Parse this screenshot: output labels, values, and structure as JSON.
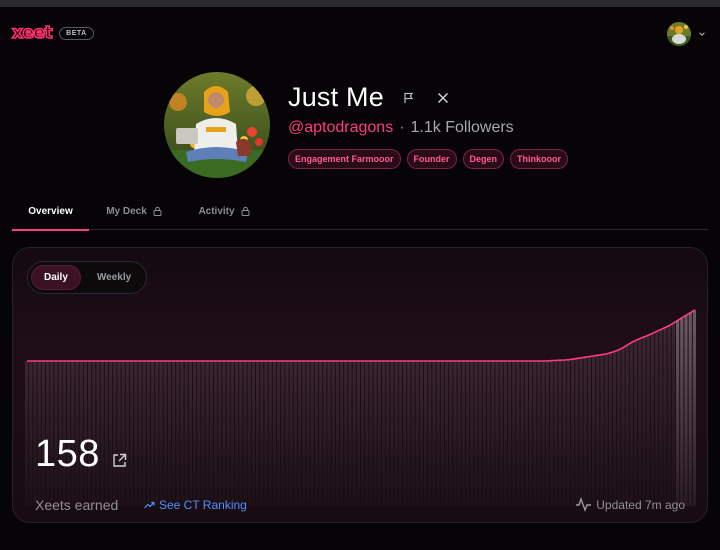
{
  "app": {
    "logo_text": "xeet",
    "beta_label": "BETA"
  },
  "account": {
    "avatar_icon": "user-avatar",
    "menu_icon": "chevron-down-icon"
  },
  "profile": {
    "display_name": "Just Me",
    "handle": "@aptodragons",
    "separator": "·",
    "followers": "1.1k Followers",
    "tags": [
      "Engagement Farmooor",
      "Founder",
      "Degen",
      "Thinkooor"
    ]
  },
  "tabs": [
    {
      "label": "Overview",
      "active": true,
      "locked": false
    },
    {
      "label": "My Deck",
      "active": false,
      "locked": true
    },
    {
      "label": "Activity",
      "active": false,
      "locked": true
    }
  ],
  "stats": {
    "period_toggle": [
      {
        "label": "Daily",
        "selected": true
      },
      {
        "label": "Weekly",
        "selected": false
      }
    ],
    "value": "158",
    "value_label": "Xeets earned",
    "ranking_link": "See CT Ranking",
    "updated": "Updated 7m ago"
  },
  "colors": {
    "accent": "#ff3d7f",
    "link": "#4f8fff",
    "background": "#060406"
  },
  "chart_data": {
    "type": "area",
    "title": "",
    "xlabel": "",
    "ylabel": "",
    "y": [
      1,
      1,
      1,
      1,
      1,
      1,
      1,
      1,
      1,
      1,
      1,
      1,
      1,
      1,
      1,
      1,
      1,
      1,
      1,
      1,
      1,
      1,
      1,
      1,
      1,
      1,
      1,
      1,
      1,
      1,
      1,
      1,
      1,
      1,
      1,
      1,
      1,
      1,
      1,
      1,
      1,
      1,
      1,
      1,
      1,
      1,
      1,
      1,
      1,
      1,
      1,
      1,
      1,
      1,
      1,
      1,
      1,
      1,
      1,
      1,
      1,
      1,
      1,
      1,
      1,
      1,
      1,
      1,
      1,
      1,
      1,
      1,
      1,
      1,
      1,
      1,
      1,
      1,
      1,
      1,
      1,
      1,
      1,
      1,
      1,
      1,
      1,
      1,
      1,
      1,
      1,
      1,
      1,
      1,
      1,
      1,
      1,
      1,
      1,
      1,
      1,
      1,
      1,
      1,
      1,
      1,
      1,
      1,
      1,
      1,
      1,
      1,
      1,
      1,
      1,
      1,
      1,
      1,
      1,
      1,
      1,
      1,
      1,
      1,
      1,
      1.5,
      2,
      2.5,
      3,
      4,
      6,
      8,
      10,
      12,
      14,
      16,
      18,
      20,
      22,
      26,
      30,
      35,
      42,
      50,
      58,
      64,
      70,
      75,
      80,
      86,
      92,
      98,
      104,
      110,
      118,
      126,
      134,
      142,
      150,
      158
    ],
    "ylim": [
      0,
      170
    ]
  }
}
